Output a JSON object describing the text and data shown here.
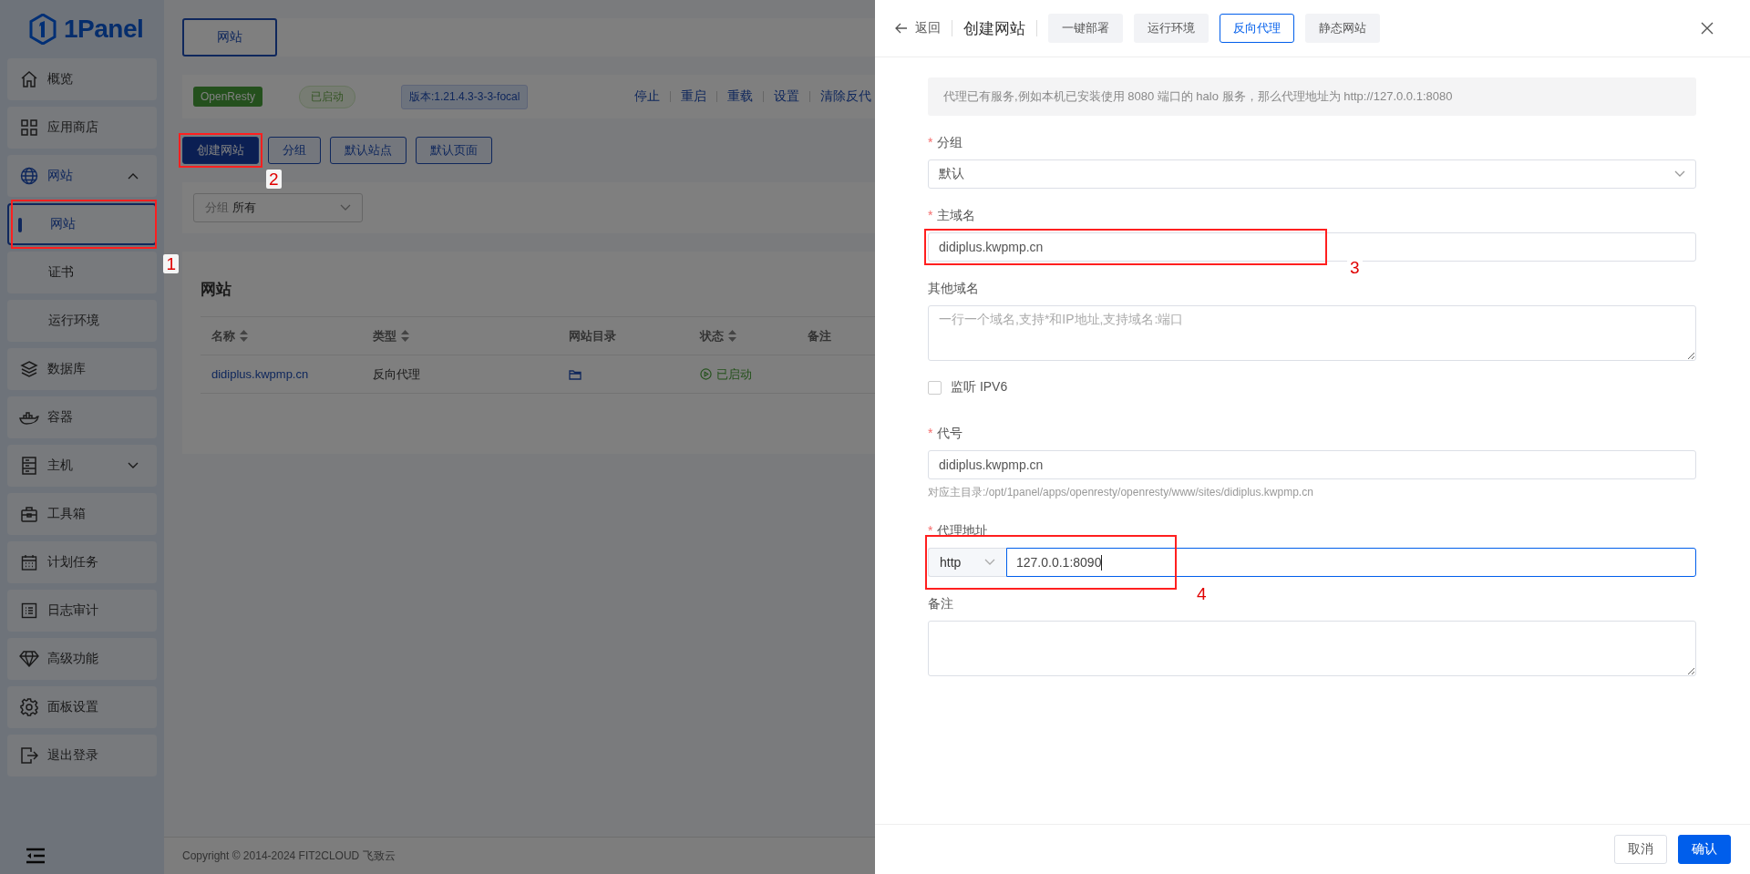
{
  "sidebar": {
    "logo": "1Panel",
    "items": [
      {
        "label": "概览"
      },
      {
        "label": "应用商店"
      },
      {
        "label": "网站",
        "expanded": true,
        "children": [
          {
            "label": "网站",
            "selected": true,
            "callout": "1"
          },
          {
            "label": "证书",
            "selected": false
          },
          {
            "label": "运行环境",
            "selected": false
          }
        ]
      },
      {
        "label": "数据库"
      },
      {
        "label": "容器"
      },
      {
        "label": "主机",
        "expanded": false
      },
      {
        "label": "工具箱"
      },
      {
        "label": "计划任务"
      },
      {
        "label": "日志审计"
      },
      {
        "label": "高级功能"
      },
      {
        "label": "面板设置"
      },
      {
        "label": "退出登录"
      }
    ]
  },
  "main": {
    "page_tab": "网站",
    "status_bar": {
      "app": "OpenResty",
      "state": "已启动",
      "version": "版本:1.21.4.3-3-3-focal",
      "actions": [
        "停止",
        "重启",
        "重载",
        "设置",
        "清除反代"
      ]
    },
    "toolbar": [
      {
        "label": "创建网站",
        "kind": "primary",
        "callout": "2"
      },
      {
        "label": "分组",
        "kind": "plain"
      },
      {
        "label": "默认站点",
        "kind": "plain"
      },
      {
        "label": "默认页面",
        "kind": "plain"
      }
    ],
    "filter": {
      "label": "分组",
      "value": "所有"
    },
    "table": {
      "title": "网站",
      "columns": [
        {
          "label": "名称",
          "sortable": true
        },
        {
          "label": "类型",
          "sortable": true
        },
        {
          "label": "网站目录",
          "sortable": false
        },
        {
          "label": "状态",
          "sortable": true
        },
        {
          "label": "备注",
          "sortable": false
        }
      ],
      "rows": [
        {
          "name": "didiplus.kwpmp.cn",
          "type": "反向代理",
          "status": "已启动"
        }
      ]
    },
    "footer": "Copyright © 2014-2024 FIT2CLOUD 飞致云"
  },
  "drawer": {
    "back": "返回",
    "title": "创建网站",
    "tabs": [
      {
        "label": "一键部署",
        "selected": false
      },
      {
        "label": "运行环境",
        "selected": false
      },
      {
        "label": "反向代理",
        "selected": true
      },
      {
        "label": "静态网站",
        "selected": false
      }
    ],
    "notice": "代理已有服务,例如本机已安装使用 8080 端口的 halo 服务，那么代理地址为 http://127.0.0.1:8080",
    "fields": [
      {
        "kind": "select",
        "required_mark": "*",
        "label": "分组",
        "value": "默认"
      },
      {
        "kind": "input",
        "required_mark": "*",
        "label": "主域名",
        "value": "didiplus.kwpmp.cn",
        "callout": "3"
      },
      {
        "kind": "textarea",
        "label": "其他域名",
        "placeholder": "一行一个域名,支持*和IP地址,支持域名:端口"
      },
      {
        "kind": "checkbox",
        "label": "监听 IPV6",
        "checked": false
      },
      {
        "kind": "input",
        "required_mark": "*",
        "label": "代号",
        "value": "didiplus.kwpmp.cn",
        "hint": "对应主目录:/opt/1panel/apps/openresty/openresty/www/sites/didiplus.kwpmp.cn"
      },
      {
        "kind": "proxy",
        "required_mark": "*",
        "label": "代理地址",
        "protocol": "http",
        "value": "127.0.0.1:8090",
        "callout": "4"
      },
      {
        "kind": "textarea",
        "label": "备注"
      }
    ],
    "buttons": [
      {
        "label": "取消",
        "kind": "plain"
      },
      {
        "label": "确认",
        "kind": "primary"
      }
    ]
  }
}
